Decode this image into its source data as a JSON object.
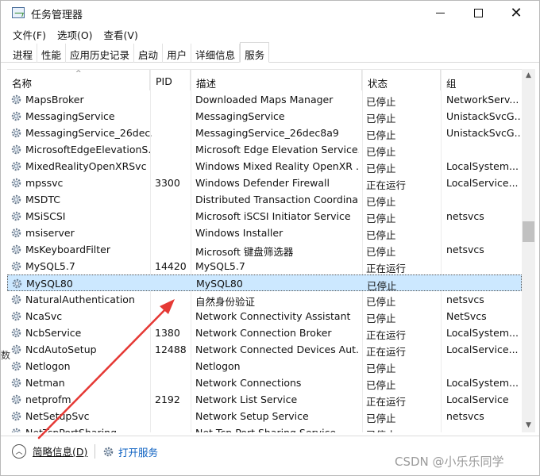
{
  "window": {
    "title": "任务管理器",
    "minimize_icon": "minimize-icon",
    "maximize_icon": "maximize-icon",
    "close_icon": "close-icon",
    "close_glyph": "✕"
  },
  "menu": [
    {
      "label": "文件(F)"
    },
    {
      "label": "选项(O)"
    },
    {
      "label": "查看(V)"
    }
  ],
  "tabs": [
    {
      "label": "进程",
      "active": false
    },
    {
      "label": "性能",
      "active": false
    },
    {
      "label": "应用历史记录",
      "active": false
    },
    {
      "label": "启动",
      "active": false
    },
    {
      "label": "用户",
      "active": false
    },
    {
      "label": "详细信息",
      "active": false
    },
    {
      "label": "服务",
      "active": true
    }
  ],
  "columns": {
    "name": "名称",
    "pid": "PID",
    "desc": "描述",
    "status": "状态",
    "group": "组",
    "sort_arrow": "^"
  },
  "services": [
    {
      "name": "MapsBroker",
      "pid": "",
      "desc": "Downloaded Maps Manager",
      "status": "已停止",
      "group": "NetworkServ..."
    },
    {
      "name": "MessagingService",
      "pid": "",
      "desc": "MessagingService",
      "status": "已停止",
      "group": "UnistackSvcG..."
    },
    {
      "name": "MessagingService_26dec...",
      "pid": "",
      "desc": "MessagingService_26dec8a9",
      "status": "已停止",
      "group": "UnistackSvcG..."
    },
    {
      "name": "MicrosoftEdgeElevationS...",
      "pid": "",
      "desc": "Microsoft Edge Elevation Service...",
      "status": "已停止",
      "group": ""
    },
    {
      "name": "MixedRealityOpenXRSvc",
      "pid": "",
      "desc": "Windows Mixed Reality OpenXR ...",
      "status": "已停止",
      "group": "LocalSystem..."
    },
    {
      "name": "mpssvc",
      "pid": "3300",
      "desc": "Windows Defender Firewall",
      "status": "正在运行",
      "group": "LocalService..."
    },
    {
      "name": "MSDTC",
      "pid": "",
      "desc": "Distributed Transaction Coordina...",
      "status": "已停止",
      "group": ""
    },
    {
      "name": "MSiSCSI",
      "pid": "",
      "desc": "Microsoft iSCSI Initiator Service",
      "status": "已停止",
      "group": "netsvcs"
    },
    {
      "name": "msiserver",
      "pid": "",
      "desc": "Windows Installer",
      "status": "已停止",
      "group": ""
    },
    {
      "name": "MsKeyboardFilter",
      "pid": "",
      "desc": "Microsoft 键盘筛选器",
      "status": "已停止",
      "group": "netsvcs"
    },
    {
      "name": "MySQL5.7",
      "pid": "14420",
      "desc": "MySQL5.7",
      "status": "正在运行",
      "group": ""
    },
    {
      "name": "MySQL80",
      "pid": "",
      "desc": "MySQL80",
      "status": "已停止",
      "group": "",
      "selected": true
    },
    {
      "name": "NaturalAuthentication",
      "pid": "",
      "desc": "自然身份验证",
      "status": "已停止",
      "group": "netsvcs"
    },
    {
      "name": "NcaSvc",
      "pid": "",
      "desc": "Network Connectivity Assistant",
      "status": "已停止",
      "group": "NetSvcs"
    },
    {
      "name": "NcbService",
      "pid": "1380",
      "desc": "Network Connection Broker",
      "status": "正在运行",
      "group": "LocalSystem..."
    },
    {
      "name": "NcdAutoSetup",
      "pid": "12488",
      "desc": "Network Connected Devices Aut...",
      "status": "正在运行",
      "group": "LocalService..."
    },
    {
      "name": "Netlogon",
      "pid": "",
      "desc": "Netlogon",
      "status": "已停止",
      "group": ""
    },
    {
      "name": "Netman",
      "pid": "",
      "desc": "Network Connections",
      "status": "已停止",
      "group": "LocalSystem..."
    },
    {
      "name": "netprofm",
      "pid": "2192",
      "desc": "Network List Service",
      "status": "正在运行",
      "group": "LocalService"
    },
    {
      "name": "NetSetupSvc",
      "pid": "",
      "desc": "Network Setup Service",
      "status": "已停止",
      "group": "netsvcs"
    },
    {
      "name": "NetTcpPortSharing",
      "pid": "",
      "desc": "Net.Tcp Port Sharing Service",
      "status": "已停止",
      "group": ""
    }
  ],
  "scrollbar": {
    "position_fraction": 0.44,
    "visible_fraction": 0.06
  },
  "left_edge_glyph": "数",
  "footer": {
    "fewer_details": "简略信息(D)",
    "fewer_icon": "chevron-up-circle-icon",
    "open_services": "打开服务",
    "open_icon": "gear-icon"
  },
  "watermark": "CSDN @小乐乐同学",
  "colors": {
    "selected_row": "#cce8ff",
    "link": "#0a5fc1",
    "annotation_arrow": "#e53935"
  }
}
